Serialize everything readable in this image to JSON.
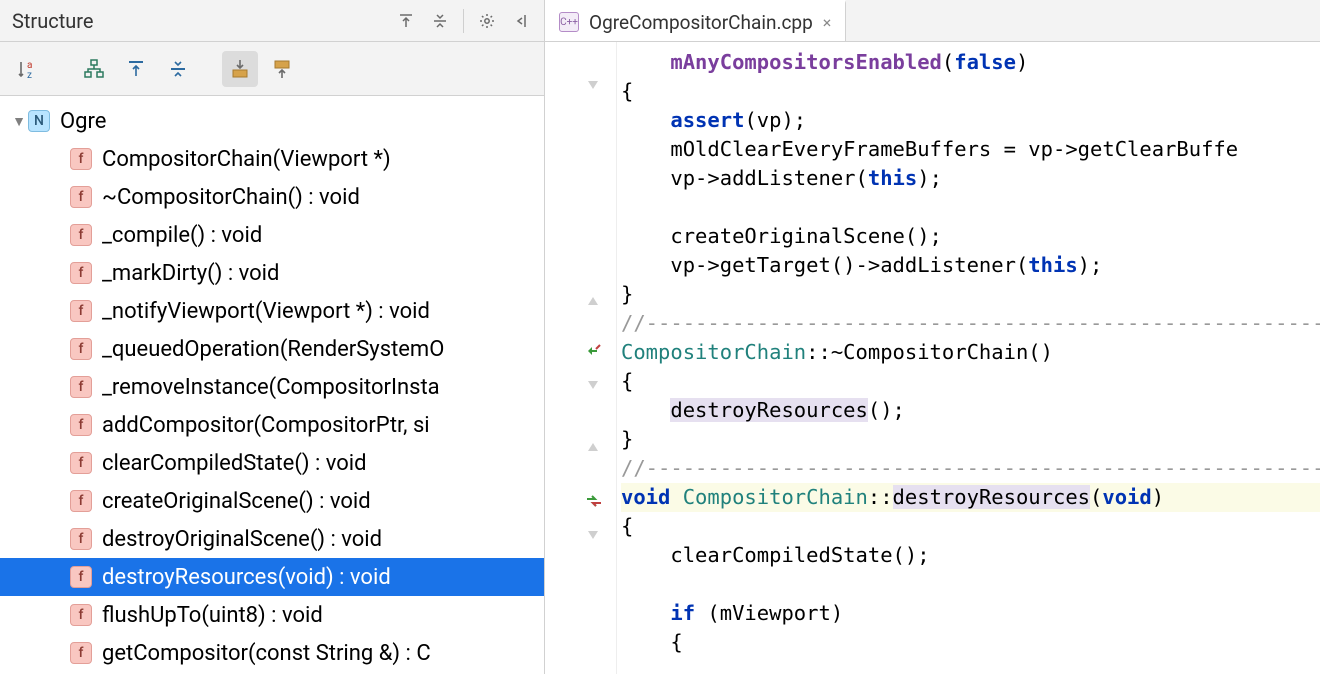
{
  "structure": {
    "title": "Structure",
    "root": {
      "label": "Ogre",
      "icon": "N"
    },
    "items": [
      {
        "label": "CompositorChain(Viewport *)"
      },
      {
        "label": "~CompositorChain() : void"
      },
      {
        "label": "_compile() : void"
      },
      {
        "label": "_markDirty() : void"
      },
      {
        "label": "_notifyViewport(Viewport *) : void"
      },
      {
        "label": "_queuedOperation(RenderSystemO"
      },
      {
        "label": "_removeInstance(CompositorInsta"
      },
      {
        "label": "addCompositor(CompositorPtr, si"
      },
      {
        "label": "clearCompiledState() : void"
      },
      {
        "label": "createOriginalScene() : void"
      },
      {
        "label": "destroyOriginalScene() : void"
      },
      {
        "label": "destroyResources(void) : void",
        "selected": true
      },
      {
        "label": "flushUpTo(uint8) : void"
      },
      {
        "label": "getCompositor(const String &) : C"
      }
    ]
  },
  "editor": {
    "tab": {
      "filename": "OgreCompositorChain.cpp",
      "lang_badge": "C++"
    },
    "code": {
      "l1_a": "mAnyCompositorsEnabled",
      "l1_b": "(",
      "l1_c": "false",
      "l1_d": ")",
      "l2": "{",
      "l3_a": "assert",
      "l3_b": "(vp);",
      "l4_a": "mOldClearEveryFrameBuffers = vp->getClearBuffe",
      "l5_a": "vp->addListener(",
      "l5_b": "this",
      "l5_c": ");",
      "l7_a": "createOriginalScene();",
      "l8_a": "vp->getTarget()->addListener(",
      "l8_b": "this",
      "l8_c": ");",
      "l9": "}",
      "l10": "//-------------------------------------------------------",
      "l11_a": "CompositorChain",
      "l11_b": "::~CompositorChain()",
      "l12": "{",
      "l13_a": "destroyResources",
      "l13_b": "();",
      "l14": "}",
      "l15": "//-------------------------------------------------------",
      "l16_a": "void",
      "l16_b": " ",
      "l16_c": "CompositorChain",
      "l16_d": "::",
      "l16_e": "destroyResources",
      "l16_f": "(",
      "l16_g": "void",
      "l16_h": ")",
      "l17": "{",
      "l18": "clearCompiledState();",
      "l20_a": "if",
      "l20_b": " (mViewport)",
      "l21": "{"
    }
  }
}
